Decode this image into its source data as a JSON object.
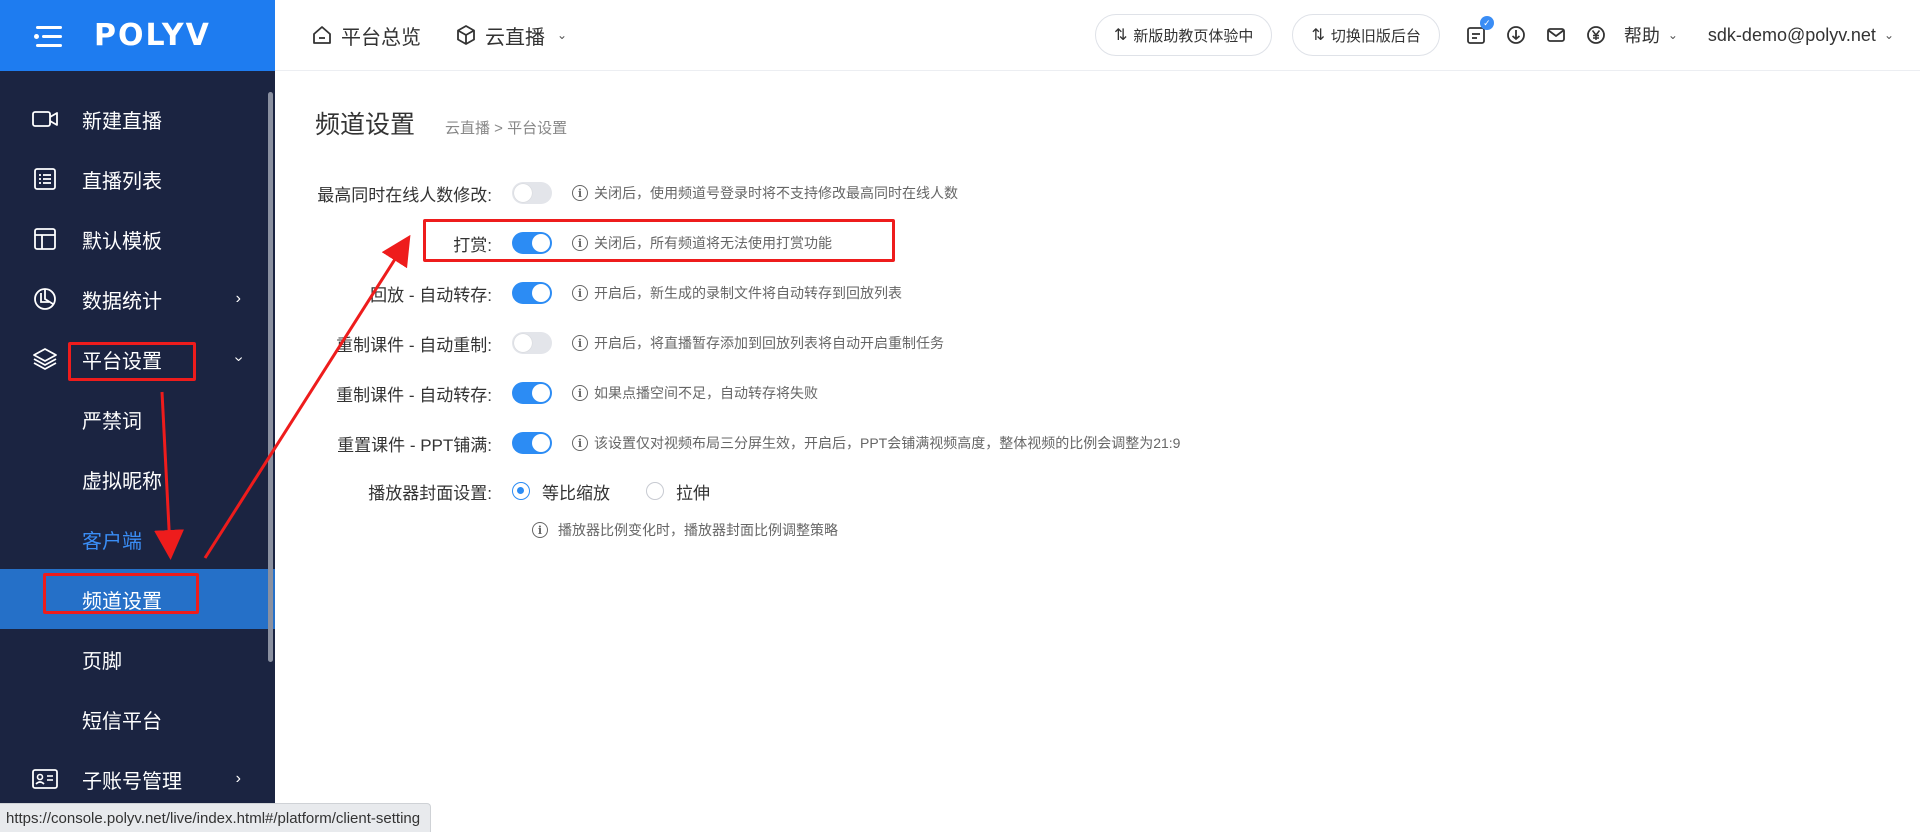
{
  "app": {
    "logo_text": "POLYV",
    "brand_color": "#1e7cf0",
    "sidebar_bg": "#1b2441",
    "accent": "#2c8cf4"
  },
  "sidebar": {
    "items": [
      {
        "label": "新建直播",
        "icon": "video-camera-icon"
      },
      {
        "label": "直播列表",
        "icon": "list-icon"
      },
      {
        "label": "默认模板",
        "icon": "template-icon"
      },
      {
        "label": "数据统计",
        "icon": "pie-chart-icon",
        "expandable": true
      },
      {
        "label": "平台设置",
        "icon": "layers-icon",
        "expanded": true
      }
    ],
    "sub_items": [
      {
        "label": "严禁词"
      },
      {
        "label": "虚拟昵称"
      },
      {
        "label": "客户端"
      },
      {
        "label": "频道设置",
        "active": true
      },
      {
        "label": "页脚"
      },
      {
        "label": "短信平台"
      }
    ],
    "bottom_item": {
      "label": "子账号管理",
      "icon": "id-card-icon",
      "expandable": true
    }
  },
  "header": {
    "overview": "平台总览",
    "cloud_live": "云直播",
    "pill_new": "新版助教页体验中",
    "pill_old": "切换旧版后台",
    "help": "帮助",
    "user": "sdk-demo@polyv.net"
  },
  "page": {
    "title": "频道设置",
    "breadcrumb": "云直播 >  平台设置"
  },
  "settings": [
    {
      "label": "最高同时在线人数修改:",
      "on": false,
      "hint": "关闭后，使用频道号登录时将不支持修改最高同时在线人数"
    },
    {
      "label": "打赏:",
      "on": true,
      "hint": "关闭后，所有频道将无法使用打赏功能"
    },
    {
      "label": "回放 - 自动转存:",
      "on": true,
      "hint": "开启后，新生成的录制文件将自动转存到回放列表"
    },
    {
      "label": "重制课件 - 自动重制:",
      "on": false,
      "hint": "开启后，将直播暂存添加到回放列表将自动开启重制任务"
    },
    {
      "label": "重制课件 - 自动转存:",
      "on": true,
      "hint": "如果点播空间不足，自动转存将失败"
    },
    {
      "label": "重置课件 - PPT铺满:",
      "on": true,
      "hint": "该设置仅对视频布局三分屏生效，开启后，PPT会铺满视频高度，整体视频的比例会调整为21:9"
    }
  ],
  "cover_setting": {
    "label": "播放器封面设置:",
    "options": [
      "等比缩放",
      "拉伸"
    ],
    "selected": "等比缩放",
    "hint": "播放器比例变化时，播放器封面比例调整策略"
  },
  "status_url": "https://console.polyv.net/live/index.html#/platform/client-setting",
  "annotation_color": "#ee1c1c"
}
